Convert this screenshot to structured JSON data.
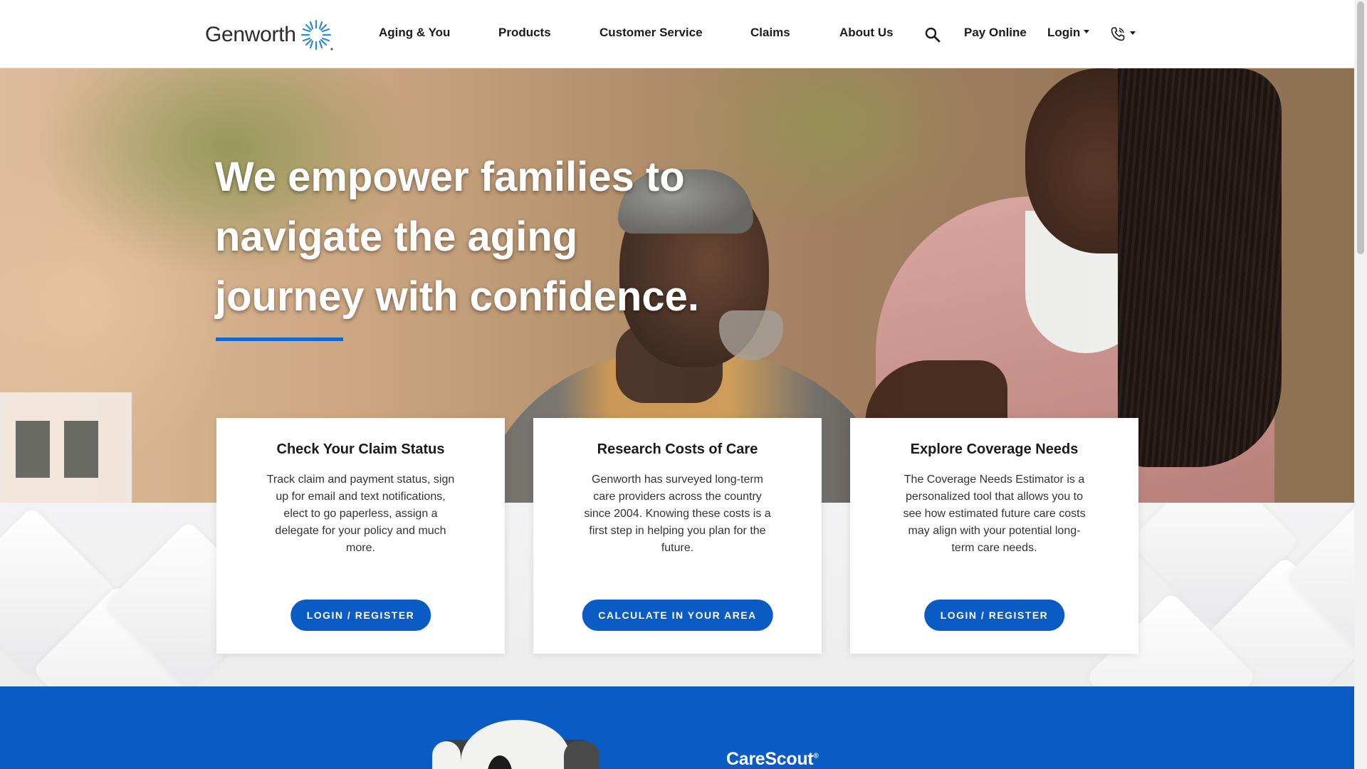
{
  "brand": {
    "name": "Genworth",
    "accent": "#0a5bc4",
    "bar_color": "#0a6ad1"
  },
  "nav": {
    "items": [
      {
        "label": "Aging & You"
      },
      {
        "label": "Products"
      },
      {
        "label": "Customer Service"
      },
      {
        "label": "Claims"
      },
      {
        "label": "About Us"
      }
    ],
    "search_icon": "search-icon",
    "pay_online": "Pay Online",
    "login": "Login",
    "phone_icon": "phone-icon"
  },
  "hero": {
    "headline": "We empower families to navigate the aging journey with confidence."
  },
  "cards": [
    {
      "title": "Check Your Claim Status",
      "body": "Track claim and payment status, sign up for email and text notifications, elect to go paperless, assign a delegate for your policy and much more.",
      "button": "LOGIN / REGISTER"
    },
    {
      "title": "Research Costs of Care",
      "body": "Genworth has surveyed long-term care providers across the country since 2004. Knowing these costs is a first step in helping you plan for the future.",
      "button": "CALCULATE IN YOUR AREA"
    },
    {
      "title": "Explore Coverage Needs",
      "body": "The Coverage Needs Estimator is a personalized tool that allows you to see how estimated future care costs may align with your potential long-term care needs.",
      "button": "LOGIN / REGISTER"
    }
  ],
  "promo": {
    "brand": "CareScout",
    "trademark": "®"
  }
}
